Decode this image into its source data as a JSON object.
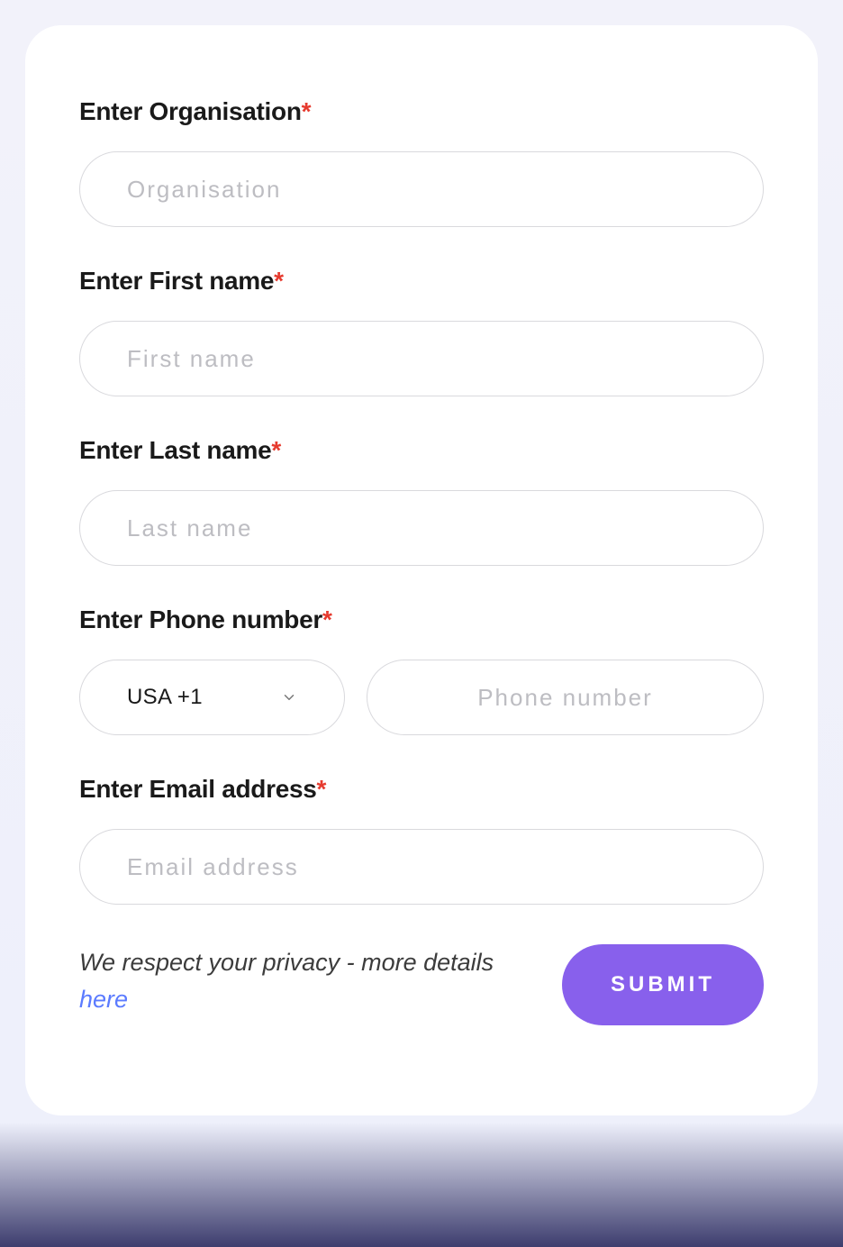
{
  "form": {
    "organisation": {
      "label": "Enter Organisation",
      "placeholder": "Organisation",
      "required": "*"
    },
    "firstName": {
      "label": "Enter First name",
      "placeholder": "First name",
      "required": "*"
    },
    "lastName": {
      "label": "Enter Last name",
      "placeholder": "Last name",
      "required": "*"
    },
    "phone": {
      "label": "Enter Phone number",
      "required": "*",
      "countrySelected": "USA +1",
      "placeholder": "Phone number"
    },
    "email": {
      "label": "Enter Email address",
      "placeholder": "Email address",
      "required": "*"
    }
  },
  "footer": {
    "privacyText": "We respect your privacy - more details ",
    "privacyLink": "here",
    "submitLabel": "SUBMIT"
  }
}
